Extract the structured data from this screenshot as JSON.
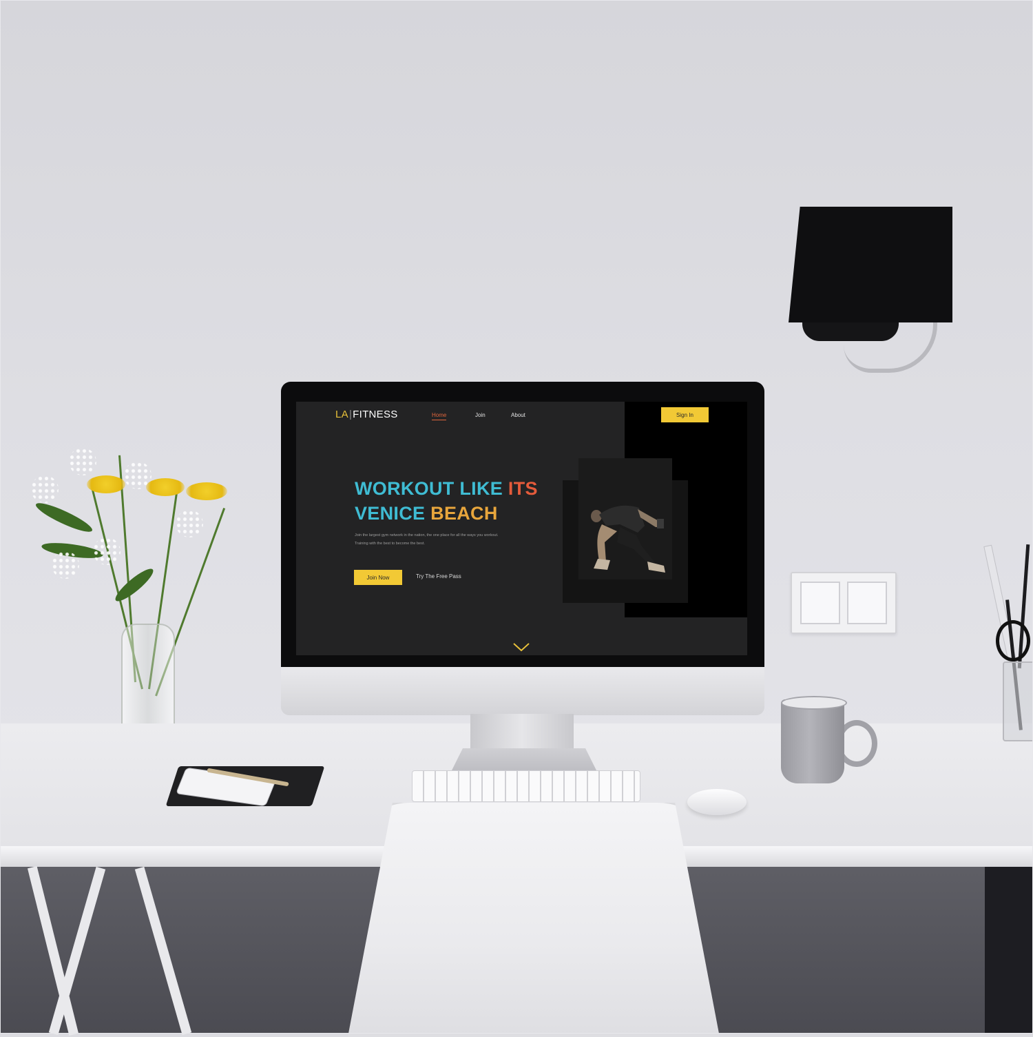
{
  "site": {
    "logo": {
      "la": "LA",
      "separator": "|",
      "fitness": "FITNESS"
    },
    "nav": [
      {
        "label": "Home",
        "active": true
      },
      {
        "label": "Join",
        "active": false
      },
      {
        "label": "About",
        "active": false
      }
    ],
    "sign_in_label": "Sign In",
    "hero": {
      "title_line1_part1": "WORKOUT LIKE",
      "title_line1_part2": "ITS",
      "title_line2_part1": "VENICE",
      "title_line2_part2": "BEACH",
      "description": "Join the largest gym network in the nation, the one place for all the ways you workout. Training with the best to become the best.",
      "join_label": "Join Now",
      "free_pass_label": "Try The Free Pass"
    },
    "scroll_icon": "chevron-down-icon"
  },
  "colors": {
    "accent_yellow": "#f2c935",
    "active_nav": "#e0663c",
    "screen_bg": "#232324",
    "title_cyan": "#3fbcd3",
    "title_orange": "#e8a63c"
  }
}
